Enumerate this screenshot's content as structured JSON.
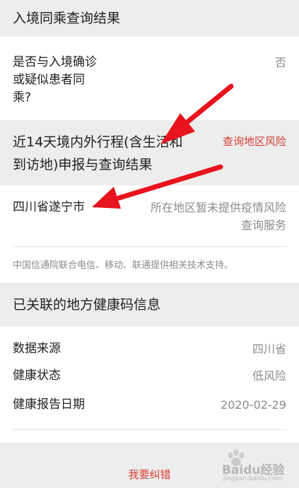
{
  "section1": {
    "title": "入境同乘查询结果",
    "row": {
      "label_lines": [
        "是否与入境确诊",
        "或疑似患者同",
        "乘?"
      ],
      "value": "否"
    }
  },
  "section2": {
    "title_lines": [
      "近14天境内外行程(含生活和",
      "到访地)申报与查询结果"
    ],
    "link": "查询地区风险",
    "row": {
      "label": "四川省遂宁市",
      "value_lines": [
        "所在地区暂未提供疫情风险",
        "查询服务"
      ]
    },
    "footnote": "中国信通院联合电信、移动、联通提供相关技术支持。"
  },
  "section3": {
    "title": "已关联的地方健康码信息",
    "rows": [
      {
        "label": "数据来源",
        "value": "四川省"
      },
      {
        "label": "健康状态",
        "value": "低风险"
      },
      {
        "label": "健康报告日期",
        "value": "2020-02-29"
      }
    ]
  },
  "footer": {
    "correct_label": "我要纠错"
  },
  "watermark": {
    "text": "Baidu经验",
    "url": "jingyan.baidu.com"
  },
  "colors": {
    "accent_red": "#d43c33",
    "arrow_red": "#e8131c",
    "section_bg": "#ededed"
  }
}
